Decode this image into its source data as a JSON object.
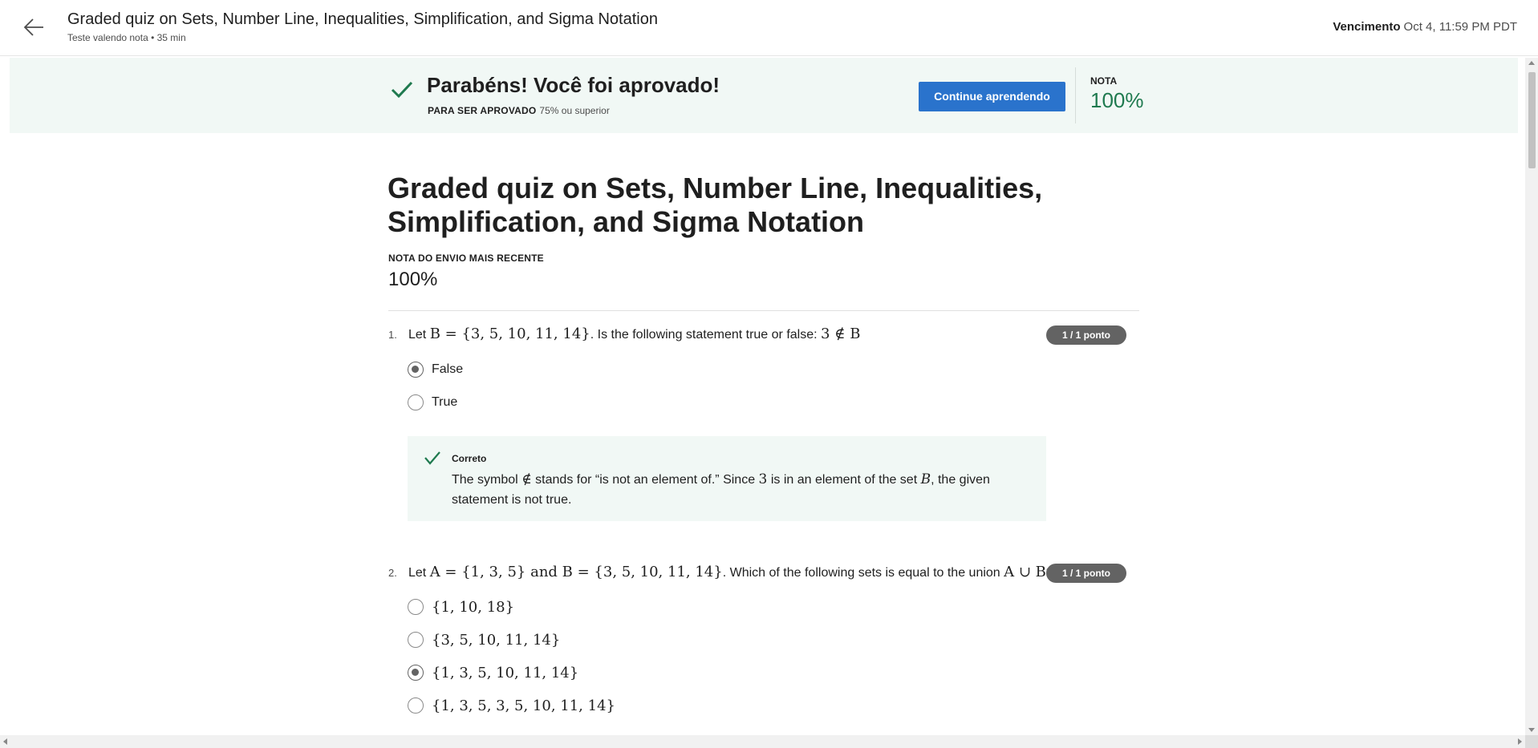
{
  "header": {
    "title": "Graded quiz on Sets, Number Line, Inequalities, Simplification, and Sigma Notation",
    "subtitle": "Teste valendo nota • 35 min",
    "due_label": "Vencimento",
    "due_value": "Oct 4, 11:59 PM PDT"
  },
  "banner": {
    "title": "Parabéns! Você foi aprovado!",
    "pass_label": "PARA SER APROVADO",
    "pass_value": "75% ou superior",
    "continue_label": "Continue aprendendo",
    "grade_label": "NOTA",
    "grade_value": "100%",
    "accent_color": "#1f7a4f",
    "button_color": "#2a73cc"
  },
  "main": {
    "title": "Graded quiz on Sets, Number Line, Inequalities, Simplification, and Sigma Notation",
    "recent_label": "NOTA DO ENVIO MAIS RECENTE",
    "recent_value": "100%"
  },
  "questions": [
    {
      "number": "1.",
      "text_pre": "Let ",
      "math_a": "B = {3, 5, 10, 11, 14}",
      "text_mid": ". Is the following statement true or false: ",
      "math_b": "3 ∉ B",
      "points": "1 / 1 ponto",
      "options": [
        {
          "label": "False",
          "selected": true
        },
        {
          "label": "True",
          "selected": false
        }
      ],
      "feedback": {
        "title": "Correto",
        "t1": "The symbol ",
        "m1": "∉",
        "t2": " stands for “is not an element of.” Since ",
        "m2": "3",
        "t3": " is in an element of the set ",
        "m3": "B",
        "t4": ", the given statement is not true."
      }
    },
    {
      "number": "2.",
      "text_pre": "Let ",
      "math_a": "A = {1, 3, 5}",
      "text_and": " and ",
      "math_b": "B = {3, 5, 10, 11, 14}",
      "text_mid": ". Which of the following sets is equal to the union ",
      "math_c": "A ∪ B",
      "text_end": "?",
      "points": "1 / 1 ponto",
      "options": [
        {
          "label": "{1, 10, 18}",
          "selected": false
        },
        {
          "label": "{3, 5, 10, 11, 14}",
          "selected": false
        },
        {
          "label": "{1, 3, 5, 10, 11, 14}",
          "selected": true
        },
        {
          "label": "{1, 3, 5, 3, 5, 10, 11, 14}",
          "selected": false
        }
      ]
    }
  ],
  "icons": {
    "back": "arrow-left-icon",
    "check": "check-icon"
  }
}
